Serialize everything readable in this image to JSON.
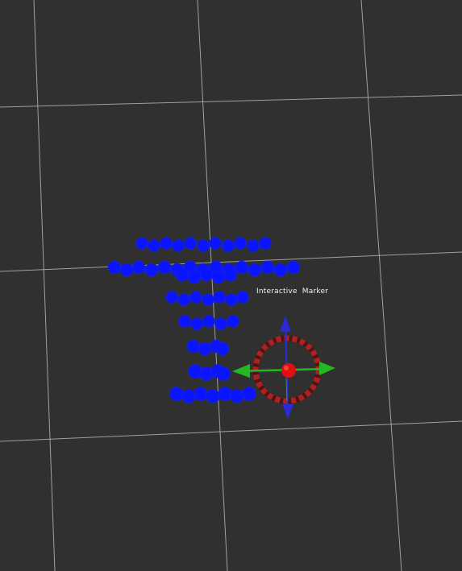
{
  "viewport": {
    "background": "#303030",
    "grid_color": "#b4b4b4"
  },
  "interactive_marker": {
    "label": "Interactive  Marker",
    "center_color": "#e01010",
    "ring_colors": [
      "#b02020",
      "#5a1a1a"
    ],
    "x_axis_color": "#22b822",
    "z_axis_color": "#2a2ad8"
  },
  "point_cloud": {
    "color": "#0a14ff",
    "shading": "#1f2ac8"
  }
}
